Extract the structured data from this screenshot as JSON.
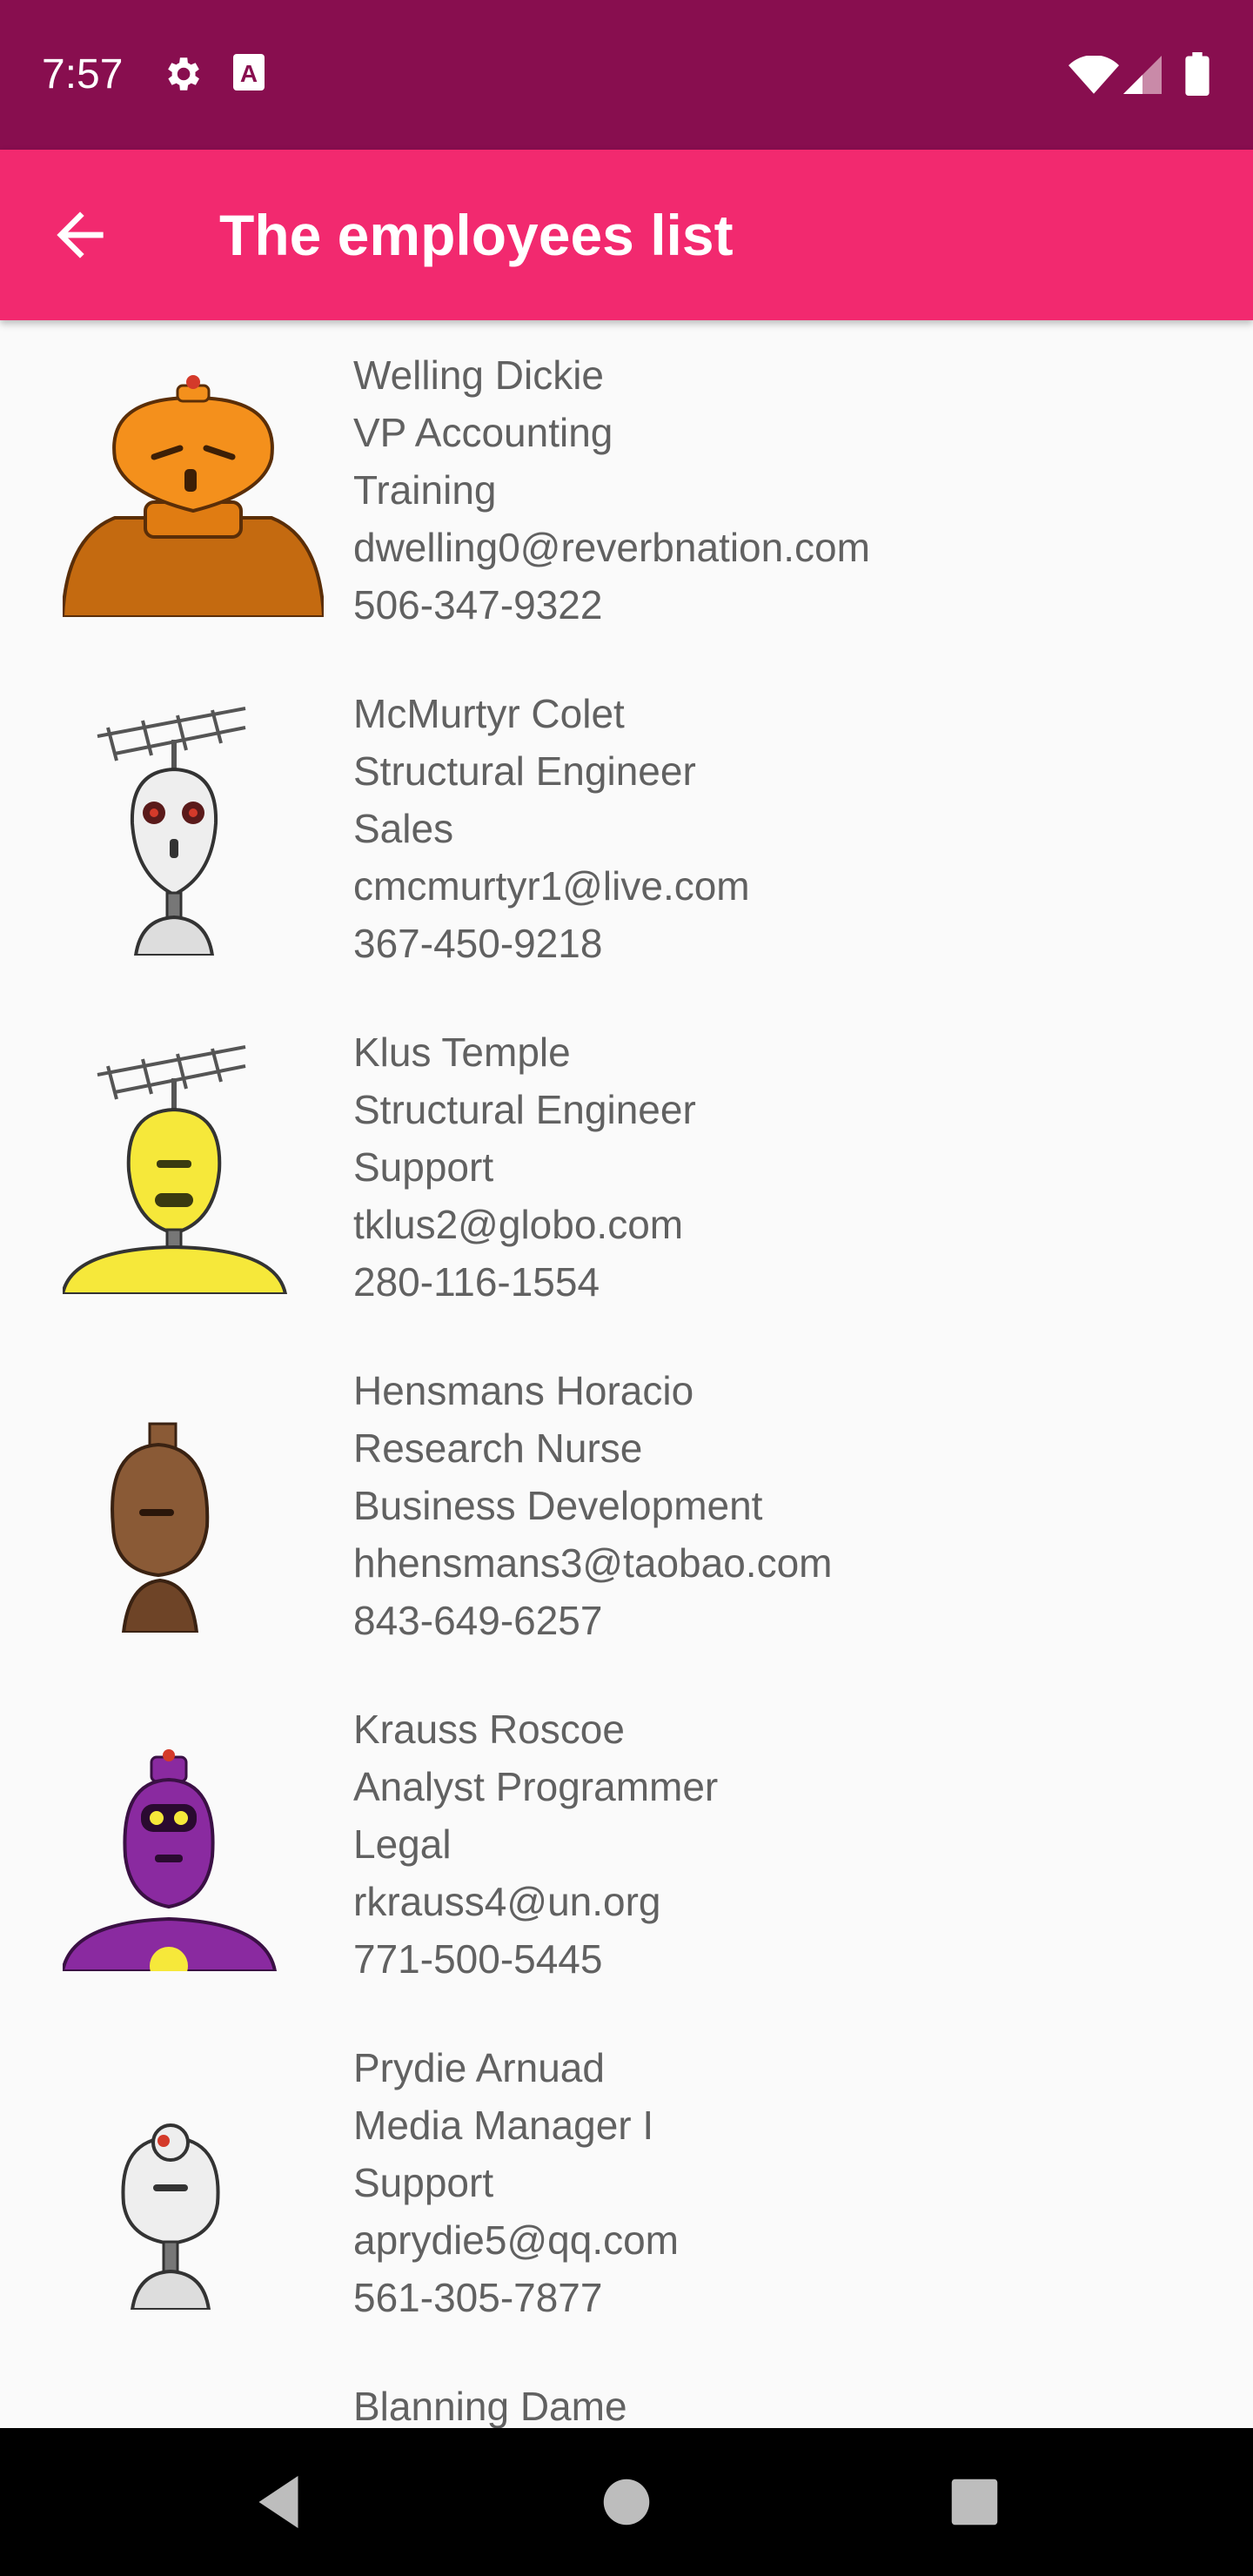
{
  "status_bar": {
    "time": "7:57",
    "icons": [
      "gear-icon",
      "keyboard-a-icon",
      "wifi-icon",
      "signal-icon",
      "battery-icon"
    ]
  },
  "app_bar": {
    "title": "The employees list",
    "back_icon": "arrow-back-icon",
    "background": "#f2296f"
  },
  "employees": [
    {
      "name": "Welling Dickie",
      "title": "VP Accounting",
      "department": "Training",
      "email": "dwelling0@reverbnation.com",
      "phone": "506-347-9322",
      "avatar": "orange-robot"
    },
    {
      "name": "McMurtyr Colet",
      "title": "Structural Engineer",
      "department": "Sales",
      "email": "cmcmurtyr1@live.com",
      "phone": "367-450-9218",
      "avatar": "white-antenna-robot"
    },
    {
      "name": "Klus Temple",
      "title": "Structural Engineer",
      "department": "Support",
      "email": "tklus2@globo.com",
      "phone": "280-116-1554",
      "avatar": "yellow-antenna-robot"
    },
    {
      "name": "Hensmans Horacio",
      "title": "Research Nurse",
      "department": "Business Development",
      "email": "hhensmans3@taobao.com",
      "phone": "843-649-6257",
      "avatar": "brown-robot"
    },
    {
      "name": "Krauss Roscoe",
      "title": "Analyst Programmer",
      "department": "Legal",
      "email": "rkrauss4@un.org",
      "phone": "771-500-5445",
      "avatar": "purple-robot"
    },
    {
      "name": "Prydie Arnuad",
      "title": "Media Manager I",
      "department": "Support",
      "email": "aprydie5@qq.com",
      "phone": "561-305-7877",
      "avatar": "white-robot"
    },
    {
      "name": "Blanning Dame",
      "title": "",
      "department": "",
      "email": "",
      "phone": "",
      "avatar": ""
    }
  ],
  "colors": {
    "status_bar": "#880e4f",
    "app_bar": "#f2296f",
    "list_background": "#fafafa",
    "text": "#616161"
  },
  "nav_bar": {
    "buttons": [
      "back-triangle-icon",
      "home-circle-icon",
      "recents-square-icon"
    ]
  }
}
